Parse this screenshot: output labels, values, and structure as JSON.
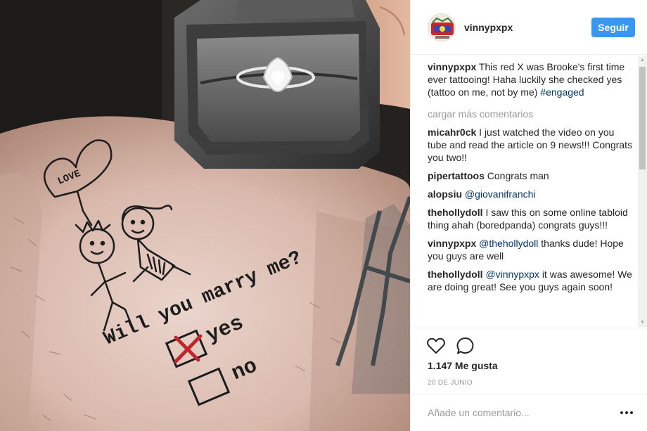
{
  "post": {
    "author": "vinnypxpx",
    "follow_label": "Seguir",
    "likes_text": "1.147 Me gusta",
    "date_text": "20 DE JUNIO"
  },
  "photo": {
    "tattoo_text_line1": "Will you marry me?",
    "heart_text": "LOVE",
    "option_yes": "yes",
    "option_no": "no"
  },
  "caption": {
    "user": "vinnypxpx",
    "text": "This red X was Brooke's first time ever tattooing! Haha luckily she checked yes (tattoo on me, not by me) ",
    "hashtag": "#engaged"
  },
  "load_more_label": "cargar más comentarios",
  "comments": [
    {
      "user": "micahr0ck",
      "mention": "",
      "text": "I just watched the video on you tube and read the article on 9 news!!! Congrats you two!!"
    },
    {
      "user": "pipertattoos",
      "mention": "",
      "text": "Congrats man"
    },
    {
      "user": "alopsiu",
      "mention": "@giovanifranchi",
      "text": ""
    },
    {
      "user": "thehollydoll",
      "mention": "",
      "text": "I saw this on some online tabloid thing ahah (boredpanda) congrats guys!!!"
    },
    {
      "user": "vinnypxpx",
      "mention": "@thehollydoll",
      "text": "thanks dude! Hope you guys are well"
    },
    {
      "user": "thehollydoll",
      "mention": "@vinnypxpx",
      "text": "it was awesome! We are doing great! See you guys again soon!"
    }
  ],
  "comment_box": {
    "placeholder": "Añade un comentario..."
  },
  "icons": {
    "like": "heart-icon",
    "comment": "speech-bubble-icon",
    "more": "ellipsis-icon",
    "scroll_up": "scroll-up-arrow",
    "scroll_down": "scroll-down-arrow"
  },
  "colors": {
    "follow_button": "#3897f0",
    "mention": "#003569",
    "muted": "#999999",
    "tattoo_ink": "#1c1c1c",
    "tattoo_red": "#c0272d"
  }
}
